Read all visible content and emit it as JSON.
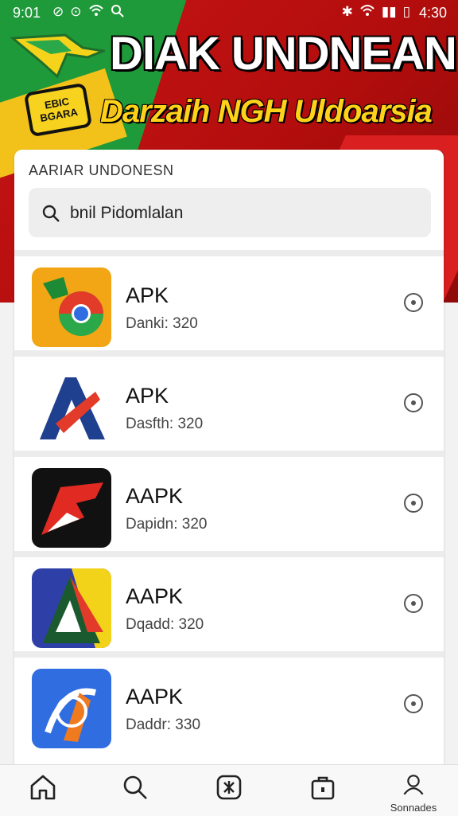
{
  "status_bar": {
    "time_left": "9:01",
    "time_right": "4:30",
    "icons_left": [
      "signal-icon",
      "wifi-icon",
      "search-icon"
    ],
    "icons_right": [
      "bluetooth-icon",
      "wifi-icon",
      "signal-icon",
      "battery-icon"
    ]
  },
  "header": {
    "title": "DIAK UNDNEAN",
    "subtitle": "Darzaih NGH Uldoarsia",
    "badge_line1": "EBIC",
    "badge_line2": "BGARA"
  },
  "panel": {
    "title": "AARIAR UNDONESN",
    "search_value": "bnil Pidomlalan"
  },
  "apps": [
    {
      "name": "APK",
      "meta": "Danki: 320",
      "icon": "chrome-like-app-icon"
    },
    {
      "name": "APK",
      "meta": "Dasfth: 320",
      "icon": "a-letter-app-icon"
    },
    {
      "name": "AAPK",
      "meta": "Dapidn: 320",
      "icon": "red-arrow-app-icon"
    },
    {
      "name": "AAPK",
      "meta": "Dqadd: 320",
      "icon": "a-triangle-app-icon"
    },
    {
      "name": "AAPK",
      "meta": "Daddr: 330",
      "icon": "blue-swirl-app-icon"
    }
  ],
  "bottom_nav": {
    "items": [
      {
        "icon": "home-icon",
        "label": ""
      },
      {
        "icon": "search-icon",
        "label": ""
      },
      {
        "icon": "apps-icon",
        "label": ""
      },
      {
        "icon": "bag-icon",
        "label": ""
      },
      {
        "icon": "profile-icon",
        "label": "Sonnades"
      }
    ]
  },
  "colors": {
    "primary_red": "#c81515",
    "green": "#1f9a3a",
    "yellow": "#f3c21a"
  }
}
